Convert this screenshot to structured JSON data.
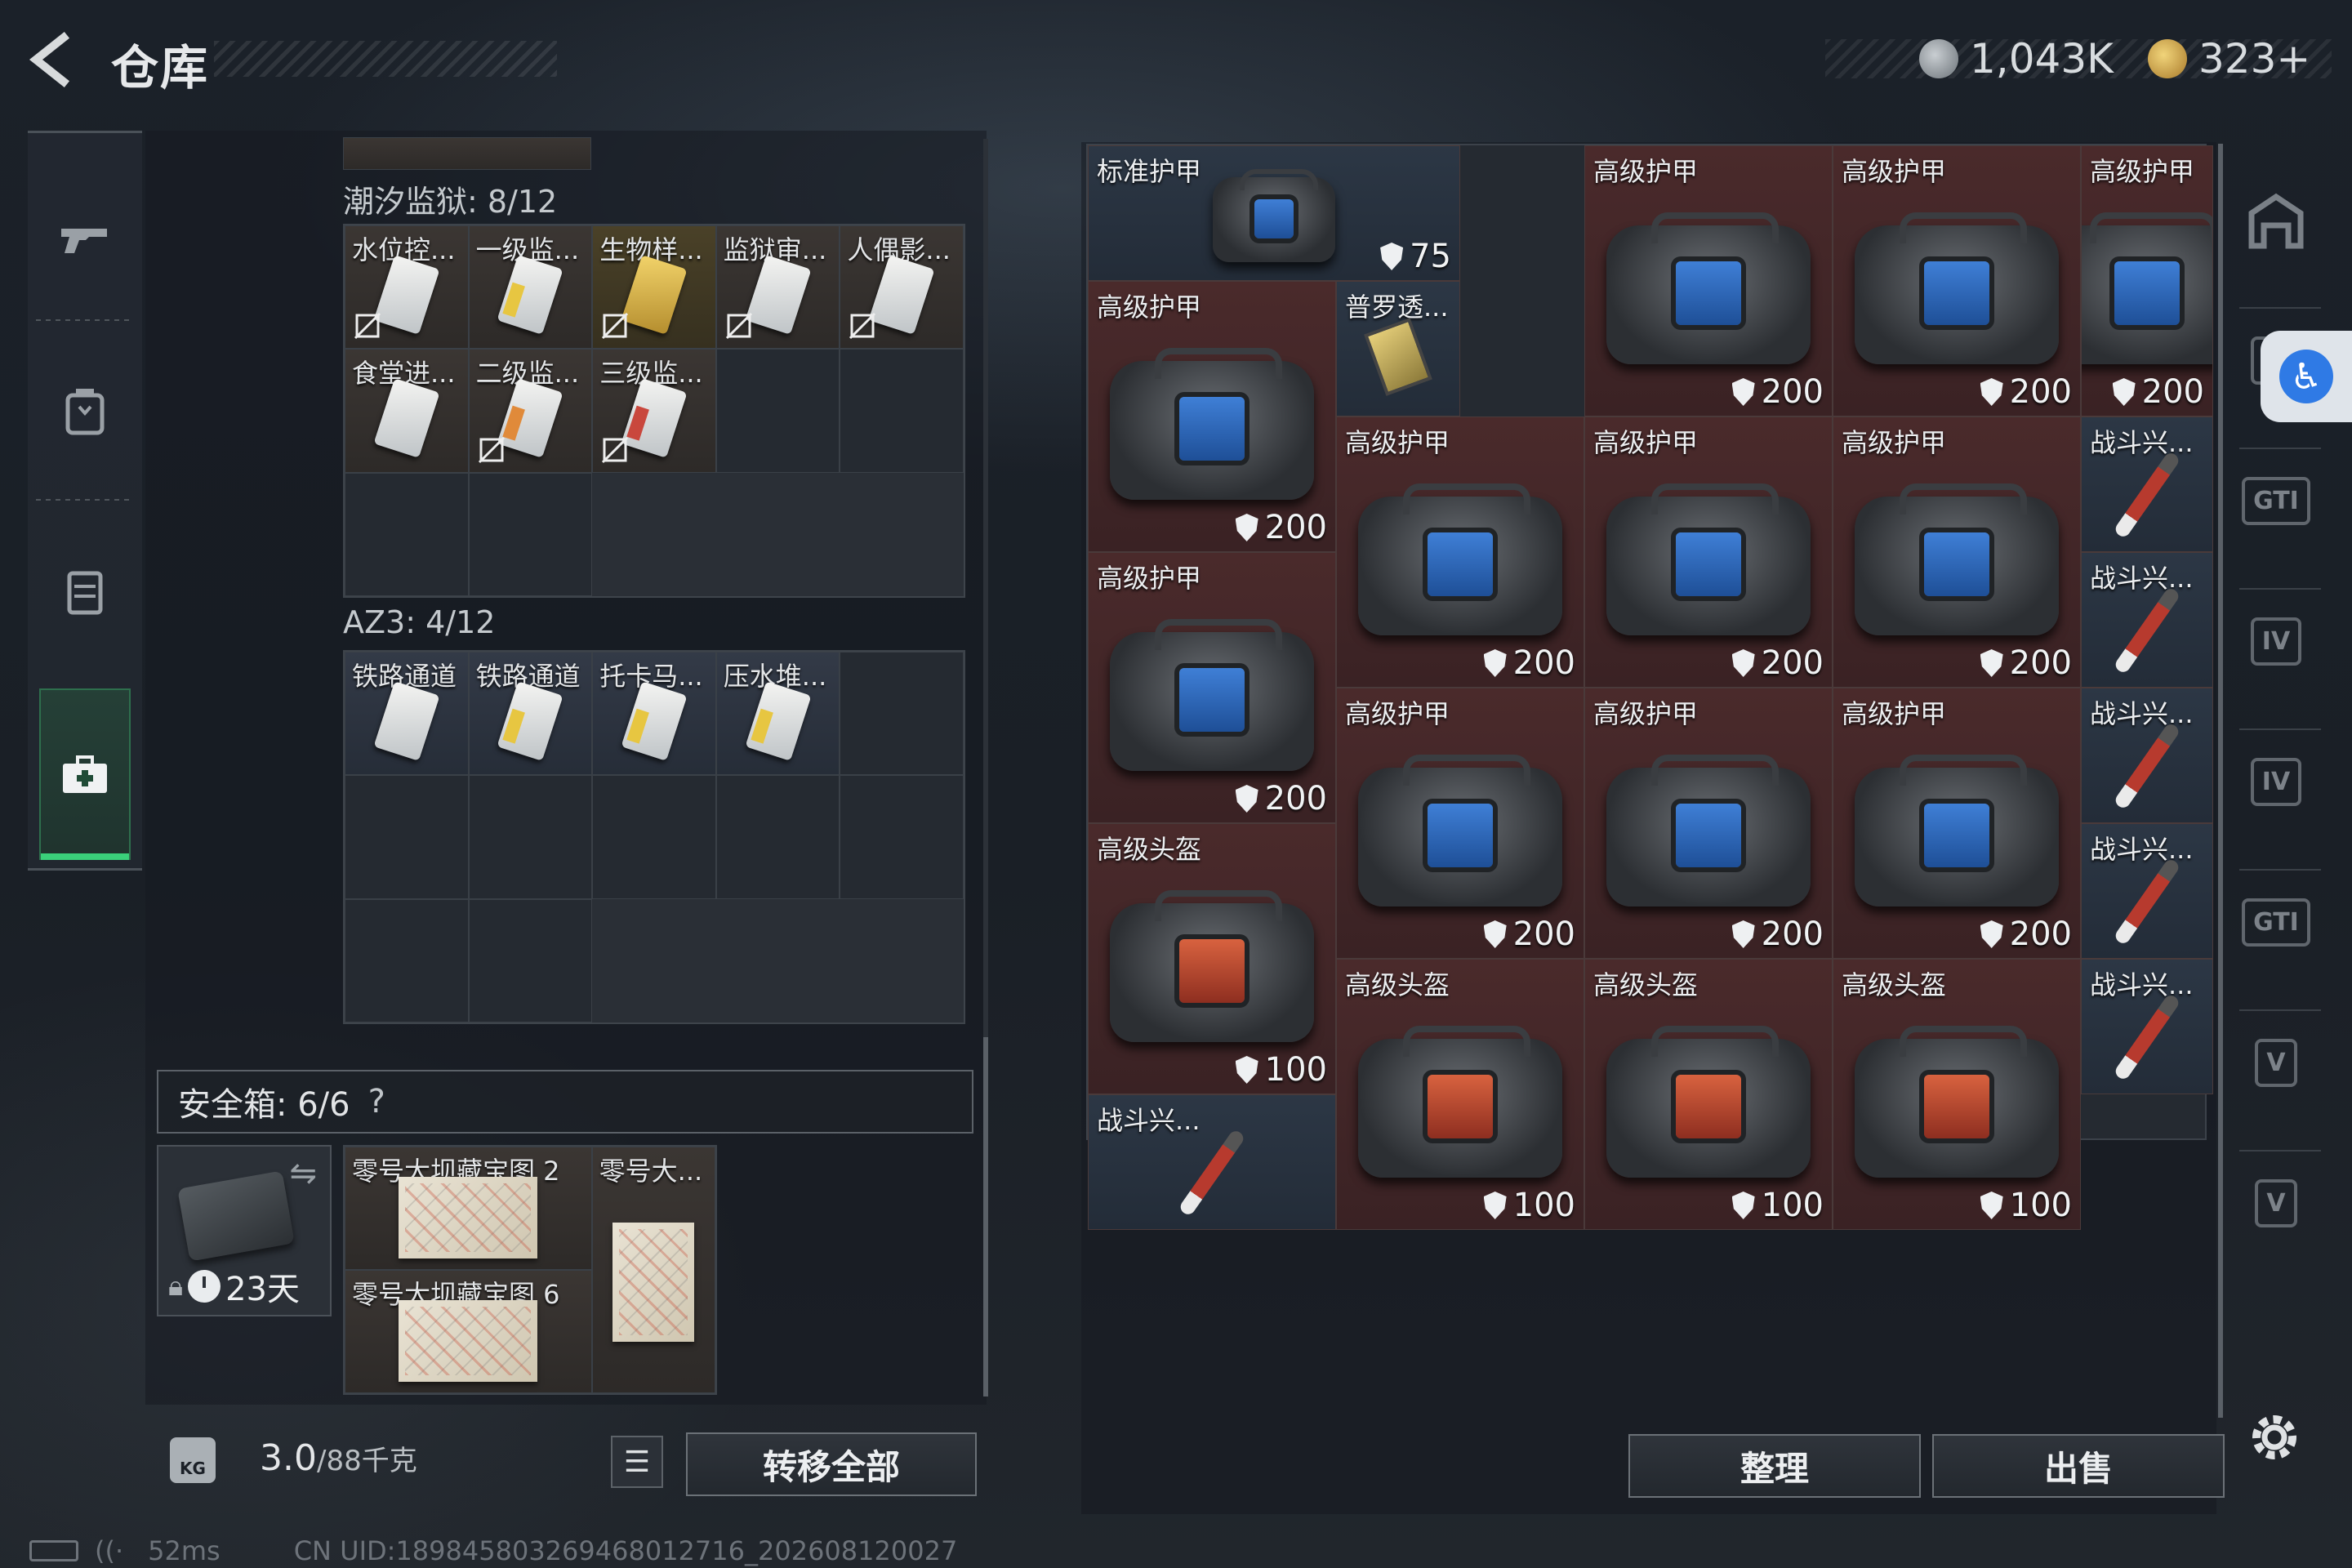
{
  "header": {
    "title": "仓库",
    "currency1": "1,043K",
    "currency2": "323+"
  },
  "sidenav": [
    "weapons-icon",
    "backpack-icon",
    "vest-icon",
    "medkit-icon"
  ],
  "containers": {
    "tidal": {
      "label": "潮汐监狱: 8/12",
      "items": [
        "水位控...",
        "一级监...",
        "生物样...",
        "监狱审...",
        "人偶影...",
        "食堂进...",
        "二级监...",
        "三级监..."
      ]
    },
    "az3": {
      "label": "AZ3: 4/12",
      "items": [
        "铁路通道",
        "铁路通道",
        "托卡马...",
        "压水堆..."
      ]
    }
  },
  "safe": {
    "label": "安全箱: 6/6",
    "help": "?",
    "days": "23天",
    "items": [
      "零号大坝藏宝图 2",
      "零号大...",
      "零号大坝藏宝图 6"
    ]
  },
  "bottom": {
    "weight": "3.0",
    "weight_max": "/88千克",
    "transfer": "转移全部",
    "organize": "整理",
    "sell": "出售"
  },
  "stash": [
    {
      "label": "标准护甲",
      "dur": "75"
    },
    {
      "label": "高级护甲",
      "dur": "200"
    },
    {
      "label": "高级护甲",
      "dur": "200"
    },
    {
      "label": "高级护甲",
      "dur": "200"
    },
    {
      "label": "高级护甲",
      "dur": "200"
    },
    {
      "label": "普罗透...",
      "dur": ""
    },
    {
      "label": "高级护甲",
      "dur": "200"
    },
    {
      "label": "高级护甲",
      "dur": "200"
    },
    {
      "label": "高级护甲",
      "dur": "200"
    },
    {
      "label": "战斗兴...",
      "dur": ""
    },
    {
      "label": "战斗兴...",
      "dur": ""
    },
    {
      "label": "高级护甲",
      "dur": "200"
    },
    {
      "label": "高级护甲",
      "dur": "200"
    },
    {
      "label": "高级护甲",
      "dur": "200"
    },
    {
      "label": "高级护甲",
      "dur": "200"
    },
    {
      "label": "战斗兴...",
      "dur": ""
    },
    {
      "label": "战斗兴...",
      "dur": ""
    },
    {
      "label": "高级头盔",
      "dur": "100"
    },
    {
      "label": "高级头盔",
      "dur": "100"
    },
    {
      "label": "高级头盔",
      "dur": "100"
    },
    {
      "label": "高级头盔",
      "dur": "100"
    },
    {
      "label": "战斗兴...",
      "dur": ""
    },
    {
      "label": "战斗兴...",
      "dur": ""
    }
  ],
  "rnav": [
    "IV",
    "GTI",
    "IV",
    "IV",
    "GTI",
    "V",
    "V"
  ],
  "status": {
    "ping": "52ms",
    "uid": "CN UID:1898458032694680127​16_202608120027"
  }
}
